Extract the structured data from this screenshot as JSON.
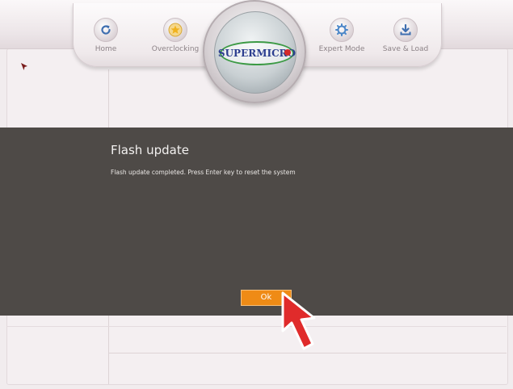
{
  "nav": {
    "items": [
      {
        "label": "Home",
        "icon": "refresh-icon"
      },
      {
        "label": "Overclocking",
        "icon": "star-icon"
      },
      {
        "label": "Expert Mode",
        "icon": "gear-icon"
      },
      {
        "label": "Save & Load",
        "icon": "download-icon"
      }
    ],
    "logo_text": "SUPERMICRO"
  },
  "dialog": {
    "title": "Flash update",
    "message": "Flash update completed. Press Enter key to reset the system",
    "ok_label": "Ok"
  },
  "colors": {
    "dialog_bg": "#4e4a47",
    "ok_button": "#ef8b16",
    "cursor_arrow": "#e02b2b",
    "page_bg": "#f1ecee",
    "logo_green": "#3c9a45",
    "logo_blue": "#2c3e8f"
  }
}
